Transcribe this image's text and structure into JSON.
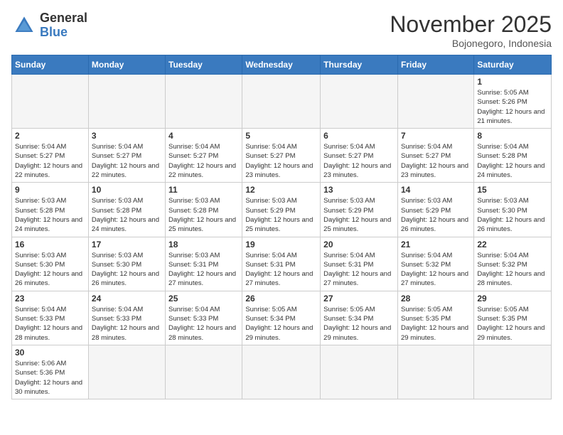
{
  "header": {
    "logo_general": "General",
    "logo_blue": "Blue",
    "month_year": "November 2025",
    "location": "Bojonegoro, Indonesia"
  },
  "weekdays": [
    "Sunday",
    "Monday",
    "Tuesday",
    "Wednesday",
    "Thursday",
    "Friday",
    "Saturday"
  ],
  "weeks": [
    [
      {
        "day": "",
        "info": ""
      },
      {
        "day": "",
        "info": ""
      },
      {
        "day": "",
        "info": ""
      },
      {
        "day": "",
        "info": ""
      },
      {
        "day": "",
        "info": ""
      },
      {
        "day": "",
        "info": ""
      },
      {
        "day": "1",
        "info": "Sunrise: 5:05 AM\nSunset: 5:26 PM\nDaylight: 12 hours and 21 minutes."
      }
    ],
    [
      {
        "day": "2",
        "info": "Sunrise: 5:04 AM\nSunset: 5:27 PM\nDaylight: 12 hours and 22 minutes."
      },
      {
        "day": "3",
        "info": "Sunrise: 5:04 AM\nSunset: 5:27 PM\nDaylight: 12 hours and 22 minutes."
      },
      {
        "day": "4",
        "info": "Sunrise: 5:04 AM\nSunset: 5:27 PM\nDaylight: 12 hours and 22 minutes."
      },
      {
        "day": "5",
        "info": "Sunrise: 5:04 AM\nSunset: 5:27 PM\nDaylight: 12 hours and 23 minutes."
      },
      {
        "day": "6",
        "info": "Sunrise: 5:04 AM\nSunset: 5:27 PM\nDaylight: 12 hours and 23 minutes."
      },
      {
        "day": "7",
        "info": "Sunrise: 5:04 AM\nSunset: 5:27 PM\nDaylight: 12 hours and 23 minutes."
      },
      {
        "day": "8",
        "info": "Sunrise: 5:04 AM\nSunset: 5:28 PM\nDaylight: 12 hours and 24 minutes."
      }
    ],
    [
      {
        "day": "9",
        "info": "Sunrise: 5:03 AM\nSunset: 5:28 PM\nDaylight: 12 hours and 24 minutes."
      },
      {
        "day": "10",
        "info": "Sunrise: 5:03 AM\nSunset: 5:28 PM\nDaylight: 12 hours and 24 minutes."
      },
      {
        "day": "11",
        "info": "Sunrise: 5:03 AM\nSunset: 5:28 PM\nDaylight: 12 hours and 25 minutes."
      },
      {
        "day": "12",
        "info": "Sunrise: 5:03 AM\nSunset: 5:29 PM\nDaylight: 12 hours and 25 minutes."
      },
      {
        "day": "13",
        "info": "Sunrise: 5:03 AM\nSunset: 5:29 PM\nDaylight: 12 hours and 25 minutes."
      },
      {
        "day": "14",
        "info": "Sunrise: 5:03 AM\nSunset: 5:29 PM\nDaylight: 12 hours and 26 minutes."
      },
      {
        "day": "15",
        "info": "Sunrise: 5:03 AM\nSunset: 5:30 PM\nDaylight: 12 hours and 26 minutes."
      }
    ],
    [
      {
        "day": "16",
        "info": "Sunrise: 5:03 AM\nSunset: 5:30 PM\nDaylight: 12 hours and 26 minutes."
      },
      {
        "day": "17",
        "info": "Sunrise: 5:03 AM\nSunset: 5:30 PM\nDaylight: 12 hours and 26 minutes."
      },
      {
        "day": "18",
        "info": "Sunrise: 5:03 AM\nSunset: 5:31 PM\nDaylight: 12 hours and 27 minutes."
      },
      {
        "day": "19",
        "info": "Sunrise: 5:04 AM\nSunset: 5:31 PM\nDaylight: 12 hours and 27 minutes."
      },
      {
        "day": "20",
        "info": "Sunrise: 5:04 AM\nSunset: 5:31 PM\nDaylight: 12 hours and 27 minutes."
      },
      {
        "day": "21",
        "info": "Sunrise: 5:04 AM\nSunset: 5:32 PM\nDaylight: 12 hours and 27 minutes."
      },
      {
        "day": "22",
        "info": "Sunrise: 5:04 AM\nSunset: 5:32 PM\nDaylight: 12 hours and 28 minutes."
      }
    ],
    [
      {
        "day": "23",
        "info": "Sunrise: 5:04 AM\nSunset: 5:33 PM\nDaylight: 12 hours and 28 minutes."
      },
      {
        "day": "24",
        "info": "Sunrise: 5:04 AM\nSunset: 5:33 PM\nDaylight: 12 hours and 28 minutes."
      },
      {
        "day": "25",
        "info": "Sunrise: 5:04 AM\nSunset: 5:33 PM\nDaylight: 12 hours and 28 minutes."
      },
      {
        "day": "26",
        "info": "Sunrise: 5:05 AM\nSunset: 5:34 PM\nDaylight: 12 hours and 29 minutes."
      },
      {
        "day": "27",
        "info": "Sunrise: 5:05 AM\nSunset: 5:34 PM\nDaylight: 12 hours and 29 minutes."
      },
      {
        "day": "28",
        "info": "Sunrise: 5:05 AM\nSunset: 5:35 PM\nDaylight: 12 hours and 29 minutes."
      },
      {
        "day": "29",
        "info": "Sunrise: 5:05 AM\nSunset: 5:35 PM\nDaylight: 12 hours and 29 minutes."
      }
    ],
    [
      {
        "day": "30",
        "info": "Sunrise: 5:06 AM\nSunset: 5:36 PM\nDaylight: 12 hours and 30 minutes."
      },
      {
        "day": "",
        "info": ""
      },
      {
        "day": "",
        "info": ""
      },
      {
        "day": "",
        "info": ""
      },
      {
        "day": "",
        "info": ""
      },
      {
        "day": "",
        "info": ""
      },
      {
        "day": "",
        "info": ""
      }
    ]
  ]
}
